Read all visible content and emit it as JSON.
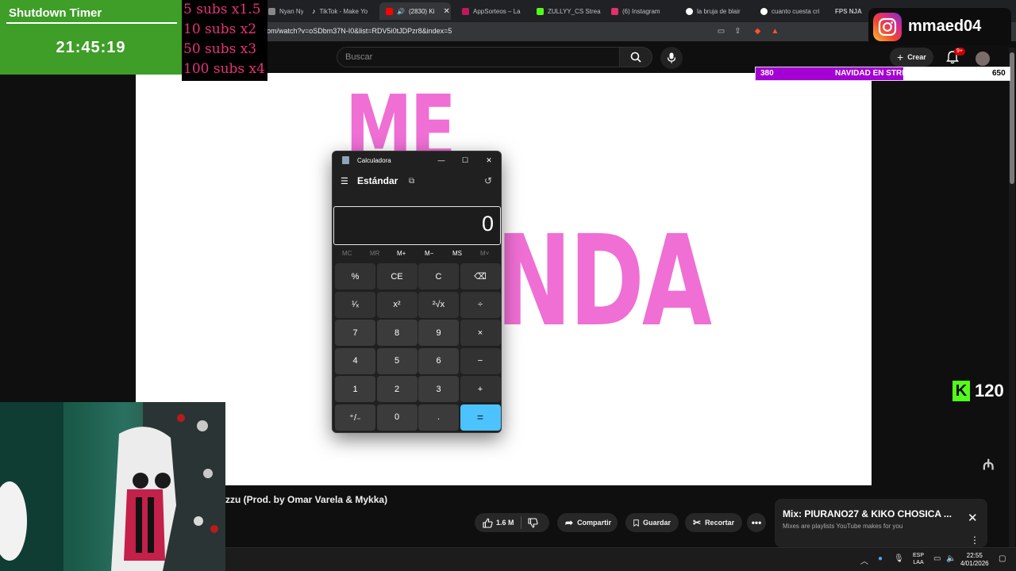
{
  "browser": {
    "tabs": [
      {
        "label": "Nyan Nyan",
        "active": false,
        "color": "#888888"
      },
      {
        "label": "TikTok - Make Yo",
        "active": false,
        "color": "#ffffff"
      },
      {
        "label": "(2830) Ki",
        "active": true,
        "color": "#ff0000"
      },
      {
        "label": "AppSorteos – La",
        "active": false,
        "color": "#c2185b"
      },
      {
        "label": "ZULLYY_CS Strea",
        "active": false,
        "color": "#53fc18"
      },
      {
        "label": "(6) Instagram",
        "active": false,
        "color": "#e1306c"
      },
      {
        "label": "la bruja de blair",
        "active": false,
        "color": "#ffffff"
      },
      {
        "label": "cuanto cuesta cri",
        "active": false,
        "color": "#ffffff"
      },
      {
        "label": "FPS NJA",
        "active": false,
        "color": "#ffffff"
      }
    ],
    "url": "om/watch?v=oSDbm37N-I0&list=RDV5i0tJDPzr8&index=5"
  },
  "youtube": {
    "search_placeholder": "Buscar",
    "create_label": "Crear",
    "notification_badge": "9+",
    "video_text_top": "ME",
    "video_text_bottom": "NDA",
    "video_title": "zzu (Prod. by Omar Varela & Mykka)",
    "actions": {
      "likes": "1.6 M",
      "share": "Compartir",
      "save": "Guardar",
      "clip": "Recortar"
    },
    "playlist": {
      "title": "Mix: PIURANO27 & KIKO CHOSICA ...",
      "subtitle": "Mixes are playlists YouTube makes for you"
    }
  },
  "overlays": {
    "timer_title": "Shutdown Timer",
    "timer_value": "21:45:19",
    "subs_lines": [
      "5 subs x1.5",
      "10 subs x2",
      "50 subs x3",
      "100 subs x4"
    ],
    "instagram_handle": "mmaed04",
    "goal": {
      "left": "380",
      "label": "NAVIDAD EN STREAM",
      "right": "650",
      "progress": 0.58
    },
    "kick_count": "120",
    "colors": {
      "timer_bg": "#3e9e28",
      "goal_fill": "#a400d4",
      "kick": "#53fc18",
      "subs_text": "#e8327a"
    }
  },
  "calculator": {
    "title": "Calculadora",
    "mode": "Estándar",
    "display": "0",
    "memory": [
      "MC",
      "MR",
      "M+",
      "M−",
      "MS",
      "M˅"
    ],
    "keys": [
      [
        "%",
        "CE",
        "C",
        "⌫"
      ],
      [
        "¹⁄ₓ",
        "x²",
        "²√x",
        "÷"
      ],
      [
        "7",
        "8",
        "9",
        "×"
      ],
      [
        "4",
        "5",
        "6",
        "−"
      ],
      [
        "1",
        "2",
        "3",
        "+"
      ],
      [
        "⁺/₋",
        "0",
        ".",
        "="
      ]
    ],
    "accent": "#4cc2ff"
  },
  "taskbar": {
    "lang_top": "ESP",
    "lang_bottom": "LAA",
    "time": "22:55",
    "date": "4/01/2026"
  }
}
